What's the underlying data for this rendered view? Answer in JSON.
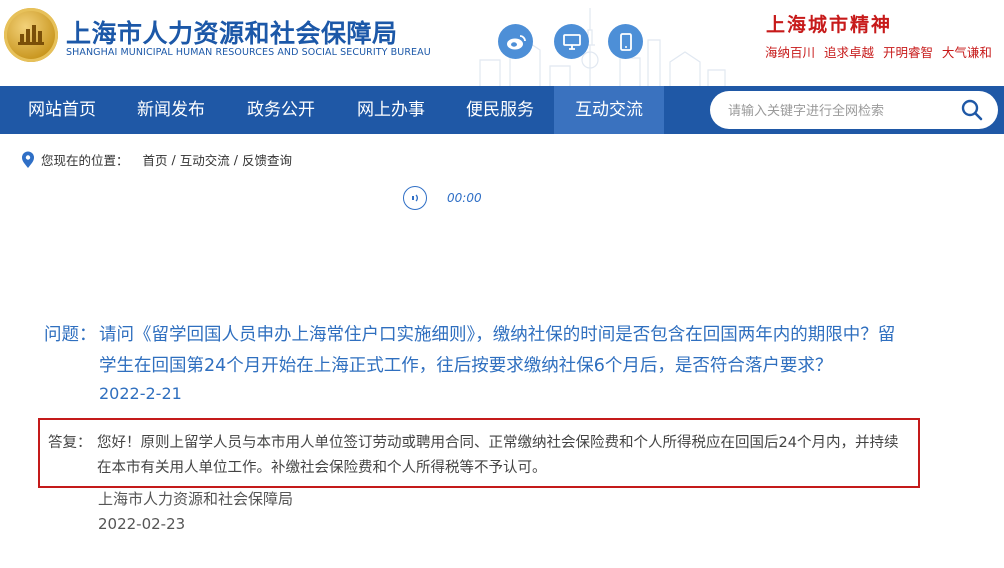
{
  "header": {
    "title": "上海市人力资源和社会保障局",
    "subtitle": "SHANGHAI MUNICIPAL HUMAN RESOURCES AND SOCIAL SECURITY BUREAU",
    "social_icons": [
      "weibo-icon",
      "desktop-icon",
      "mobile-icon"
    ],
    "slogan_title": "上海城市精神",
    "slogan": "海纳百川 追求卓越 开明睿智 大气谦和"
  },
  "nav": {
    "items": [
      {
        "label": "网站首页"
      },
      {
        "label": "新闻发布"
      },
      {
        "label": "政务公开"
      },
      {
        "label": "网上办事"
      },
      {
        "label": "便民服务"
      },
      {
        "label": "互动交流",
        "active": true
      }
    ]
  },
  "search": {
    "placeholder": "请输入关键字进行全网检索"
  },
  "breadcrumb": {
    "label": "您现在的位置：",
    "items": [
      "首页",
      "互动交流",
      "反馈查询"
    ]
  },
  "audio": {
    "time": "00:00"
  },
  "question": {
    "label": "问题：",
    "text": "请问《留学回国人员申办上海常住户口实施细则》，缴纳社保的时间是否包含在回国两年内的期限中？留学生在回国第24个月开始在上海正式工作，往后按要求缴纳社保6个月后，是否符合落户要求？",
    "date": "2022-2-21"
  },
  "answer": {
    "label": "答复：",
    "text": "您好！原则上留学人员与本市用人单位签订劳动或聘用合同、正常缴纳社会保险费和个人所得税应在回国后24个月内，并持续在本市有关用人单位工作。补缴社会保险费和个人所得税等不予认可。",
    "org": "上海市人力资源和社会保障局",
    "date": "2022-02-23"
  },
  "colors": {
    "nav_bg": "#1f58a6",
    "nav_active": "#3a72bf",
    "link_blue": "#2f6fbf",
    "highlight_red": "#c41a1a"
  }
}
